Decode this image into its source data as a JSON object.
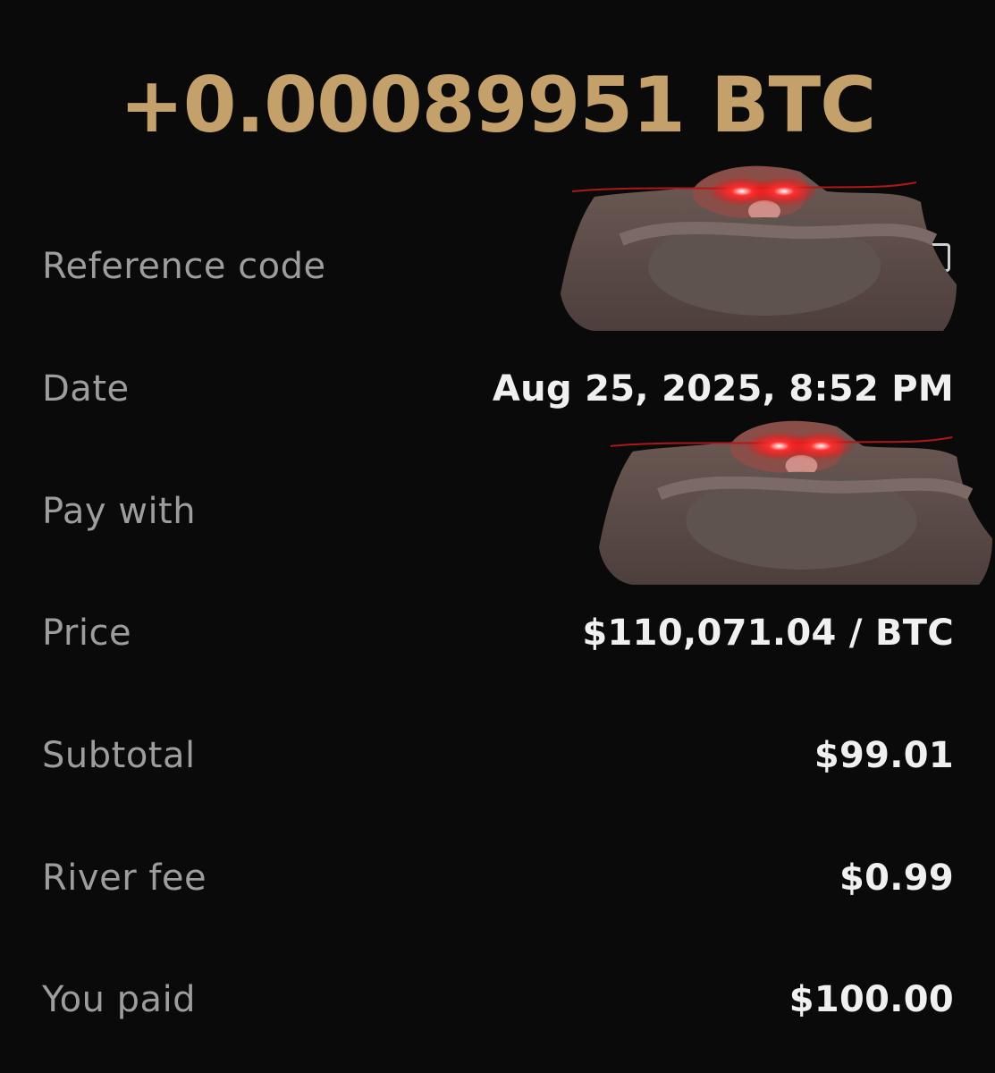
{
  "colors": {
    "accent": "#c4a06a",
    "background": "#0a0a0a",
    "label": "#9d9d9d",
    "value": "#f0f0f0"
  },
  "transaction": {
    "amount": "+0.00089951 BTC"
  },
  "details": {
    "reference_code": {
      "label": "Reference code",
      "icon": "copy-icon"
    },
    "date": {
      "label": "Date",
      "value": "Aug 25, 2025, 8:52 PM"
    },
    "pay_with": {
      "label": "Pay with"
    },
    "price": {
      "label": "Price",
      "value": "$110,071.04 / BTC"
    },
    "subtotal": {
      "label": "Subtotal",
      "value": "$99.01"
    },
    "river_fee": {
      "label": "River fee",
      "value": "$0.99"
    },
    "you_paid": {
      "label": "You paid",
      "value": "$100.00"
    }
  },
  "overlays": [
    {
      "name": "meme-sticker-monkey",
      "covers": "reference_code value"
    },
    {
      "name": "meme-sticker-monkey",
      "covers": "pay_with value"
    }
  ]
}
